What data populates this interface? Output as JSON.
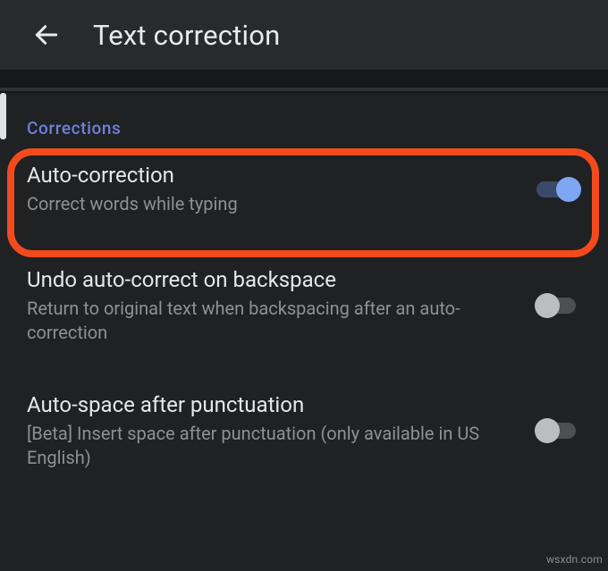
{
  "appbar": {
    "title": "Text correction"
  },
  "section": {
    "label": "Corrections"
  },
  "settings": [
    {
      "title": "Auto-correction",
      "subtitle": "Correct words while typing",
      "state": "on"
    },
    {
      "title": "Undo auto-correct on backspace",
      "subtitle": "Return to original text when backspacing after an auto-correction",
      "state": "off"
    },
    {
      "title": "Auto-space after punctuation",
      "subtitle": "[Beta] Insert space after punctuation (only available in US English)",
      "state": "off"
    }
  ],
  "watermark": "wsxdn.com"
}
